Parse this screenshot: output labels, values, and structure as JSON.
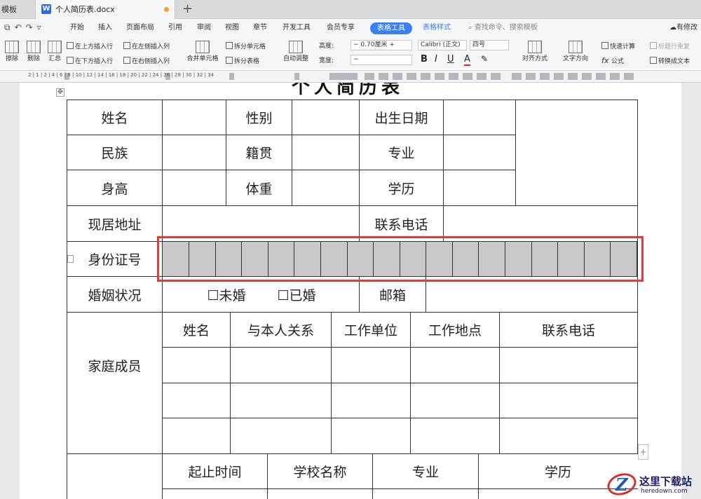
{
  "tabs": {
    "previous": "模板",
    "active_title": "个人简历表.docx",
    "add_symbol": "+"
  },
  "menu": {
    "items": [
      "开始",
      "插入",
      "页面布局",
      "引用",
      "审阅",
      "视图",
      "章节",
      "开发工具",
      "会员专享"
    ],
    "active_tool": "表格工具",
    "table_style": "表格样式",
    "search_placeholder": "查找命令、搜索模板",
    "right_label": "有修改"
  },
  "ribbon": {
    "erase": "擦除",
    "delete": "删除",
    "summary": "汇总",
    "insert_row_above": "在上方插入行",
    "insert_row_below": "在下方插入行",
    "insert_col_left": "在左侧插入列",
    "insert_col_right": "在右侧插入列",
    "merge_cells": "合并单元格",
    "split_cells": "拆分单元格",
    "split_table": "拆分表格",
    "auto_fit": "自动调整",
    "height_label": "高度:",
    "height_value": "0.70厘米",
    "width_label": "宽度:",
    "width_value": "",
    "font_name": "Calibri (正文)",
    "font_size": "四号",
    "bold": "B",
    "italic": "I",
    "underline": "U",
    "font_color": "A",
    "align": "对齐方式",
    "text_direction": "文字方向",
    "quick_calc": "快速计算",
    "formula": "公式",
    "repeat_header": "标题行重复",
    "convert_text": "转换成文本"
  },
  "ruler": {
    "numbers": "2  |  1  |  2  |  4  |  6  |  8  |  10  |  12  |  14  |  16  |  18  |  20  |  22  |  24  |  26  |  28  |  30  |  32  |  34"
  },
  "document": {
    "heading": "个人简历表",
    "labels": {
      "name": "姓名",
      "gender": "性别",
      "birth": "出生日期",
      "ethnicity": "民族",
      "native_place": "籍贯",
      "major": "专业",
      "height": "身高",
      "weight": "体重",
      "education": "学历",
      "address": "现居地址",
      "phone": "联系电话",
      "id_number": "身份证号",
      "marital": "婚姻状况",
      "unmarried": "☐未婚",
      "married": "☐已婚",
      "email": "邮箱",
      "family": "家庭成员"
    },
    "family_headers": [
      "姓名",
      "与本人关系",
      "工作单位",
      "工作地点",
      "联系电话"
    ],
    "edu_headers": [
      "起止时间",
      "学校名称",
      "专业",
      "学历"
    ]
  },
  "watermark": {
    "logo_letter": "Z",
    "site_cn": "这里下载站",
    "site_en": "heredown.com"
  },
  "colors": {
    "accent": "#3b7ff3",
    "highlight": "#e03c3c",
    "id_cells": "#c8c8c8"
  }
}
